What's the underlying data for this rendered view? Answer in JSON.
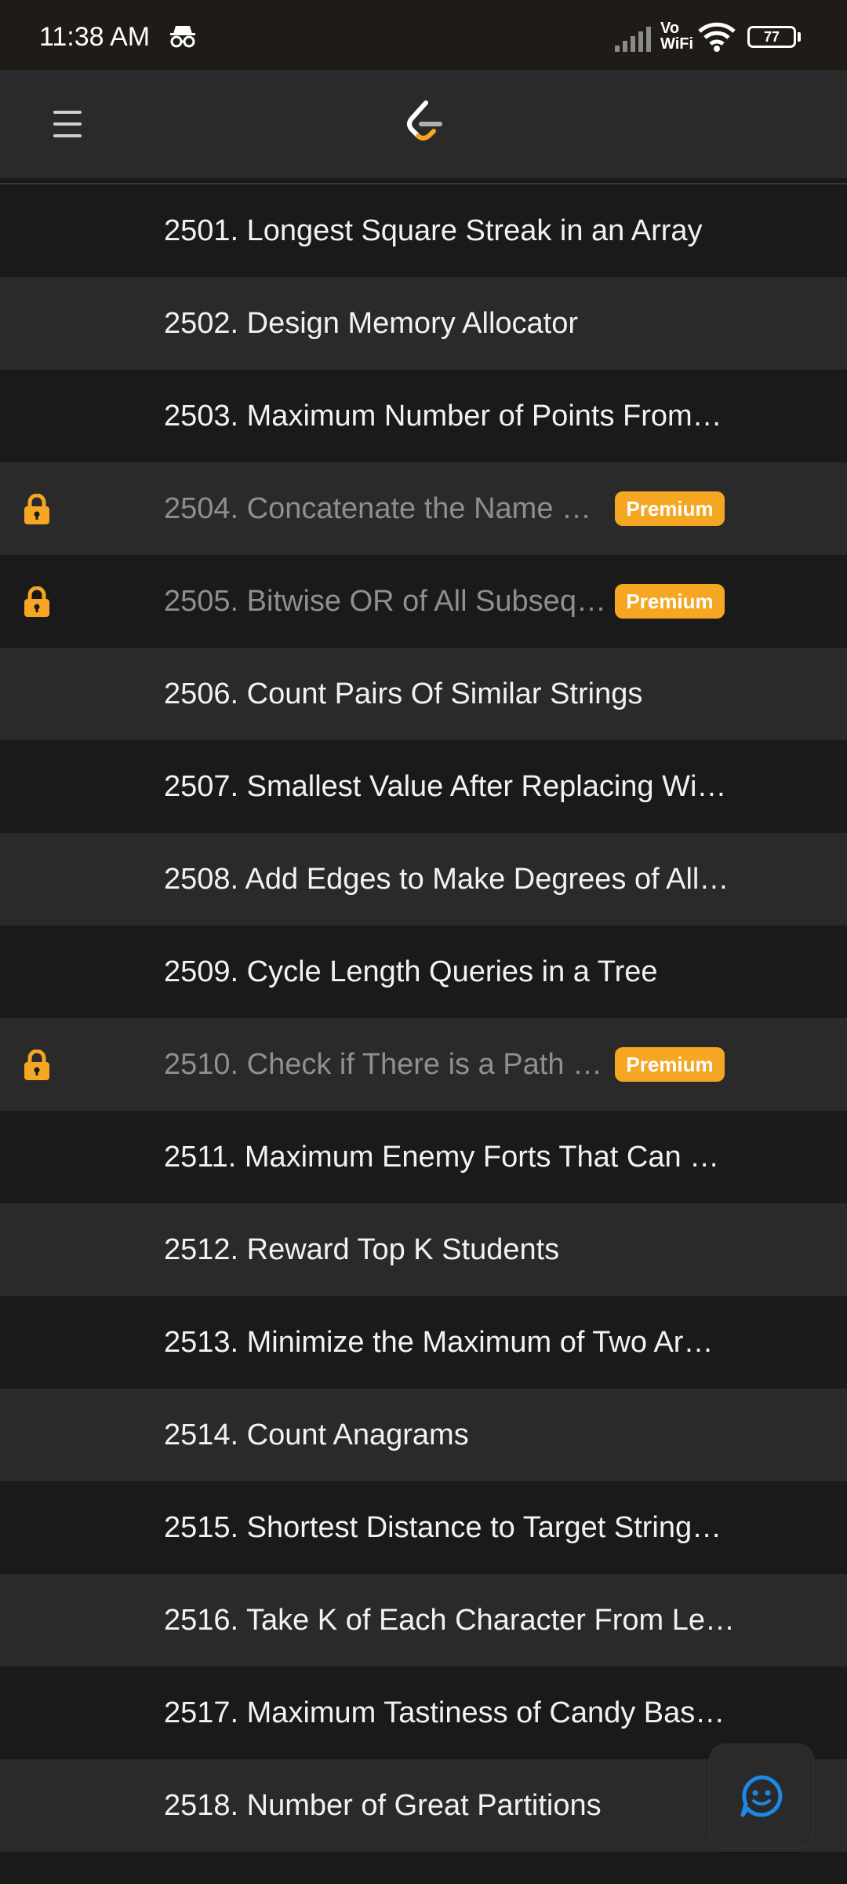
{
  "status_bar": {
    "time": "11:38 AM",
    "network_line1": "Vo",
    "network_line2": "WiFi",
    "battery": "77"
  },
  "header": {
    "menu_icon": "hamburger-menu-icon",
    "logo": "leetcode-logo"
  },
  "problems": [
    {
      "title": "2501. Longest Square Streak in an Array",
      "locked": false
    },
    {
      "title": "2502. Design Memory Allocator",
      "locked": false
    },
    {
      "title": "2503. Maximum Number of Points From…",
      "locked": false
    },
    {
      "title": "2504. Concatenate the Name …",
      "locked": true,
      "badge": "Premium"
    },
    {
      "title": "2505. Bitwise OR of All Subseq…",
      "locked": true,
      "badge": "Premium"
    },
    {
      "title": "2506. Count Pairs Of Similar Strings",
      "locked": false
    },
    {
      "title": "2507. Smallest Value After Replacing Wi…",
      "locked": false
    },
    {
      "title": "2508. Add Edges to Make Degrees of All…",
      "locked": false
    },
    {
      "title": "2509. Cycle Length Queries in a Tree",
      "locked": false
    },
    {
      "title": "2510. Check if There is a Path …",
      "locked": true,
      "badge": "Premium"
    },
    {
      "title": "2511. Maximum Enemy Forts That Can …",
      "locked": false
    },
    {
      "title": "2512. Reward Top K Students",
      "locked": false
    },
    {
      "title": "2513. Minimize the Maximum of Two Ar…",
      "locked": false
    },
    {
      "title": "2514. Count Anagrams",
      "locked": false
    },
    {
      "title": "2515. Shortest Distance to Target String…",
      "locked": false
    },
    {
      "title": "2516. Take K of Each Character From Le…",
      "locked": false
    },
    {
      "title": "2517. Maximum Tastiness of Candy Bas…",
      "locked": false
    },
    {
      "title": "2518. Number of Great Partitions",
      "locked": false
    }
  ],
  "colors": {
    "accent_orange": "#f5a623",
    "chat_blue": "#1e88e5",
    "row_dark": "#1a1a1a",
    "row_light": "#2a2a2a"
  },
  "chat_fab": {
    "icon": "chat-smiley-icon"
  }
}
